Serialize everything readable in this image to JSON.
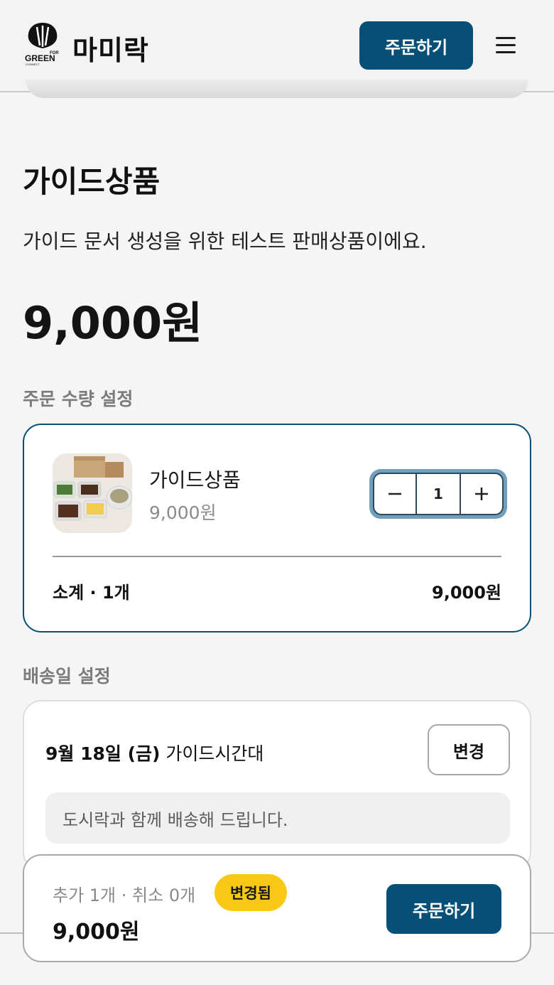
{
  "header": {
    "logo_text": "FOR GREEN CONNECT",
    "brand": "마미락",
    "order_button": "주문하기"
  },
  "product": {
    "title": "가이드상품",
    "description": "가이드 문서 생성을 위한 테스트 판매상품이에요.",
    "price": "9,000원"
  },
  "quantity_section": {
    "label": "주문 수량 설정",
    "item_name": "가이드상품",
    "item_price": "9,000원",
    "quantity": "1",
    "minus_icon": "minus-icon",
    "plus_icon": "plus-icon",
    "subtotal_label": "소계 · 1개",
    "subtotal_value": "9,000원"
  },
  "delivery_section": {
    "label": "배송일 설정",
    "date": "9월 18일 (금)",
    "timeslot": "가이드시간대",
    "change_button": "변경",
    "note": "도시락과 함께 배송해 드립니다."
  },
  "bottom_bar": {
    "counts": "추가 1개 · 취소 0개",
    "badge": "변경됨",
    "total": "9,000원",
    "order_button": "주문하기"
  },
  "colors": {
    "primary": "#064f77",
    "badge": "#f8c815"
  }
}
